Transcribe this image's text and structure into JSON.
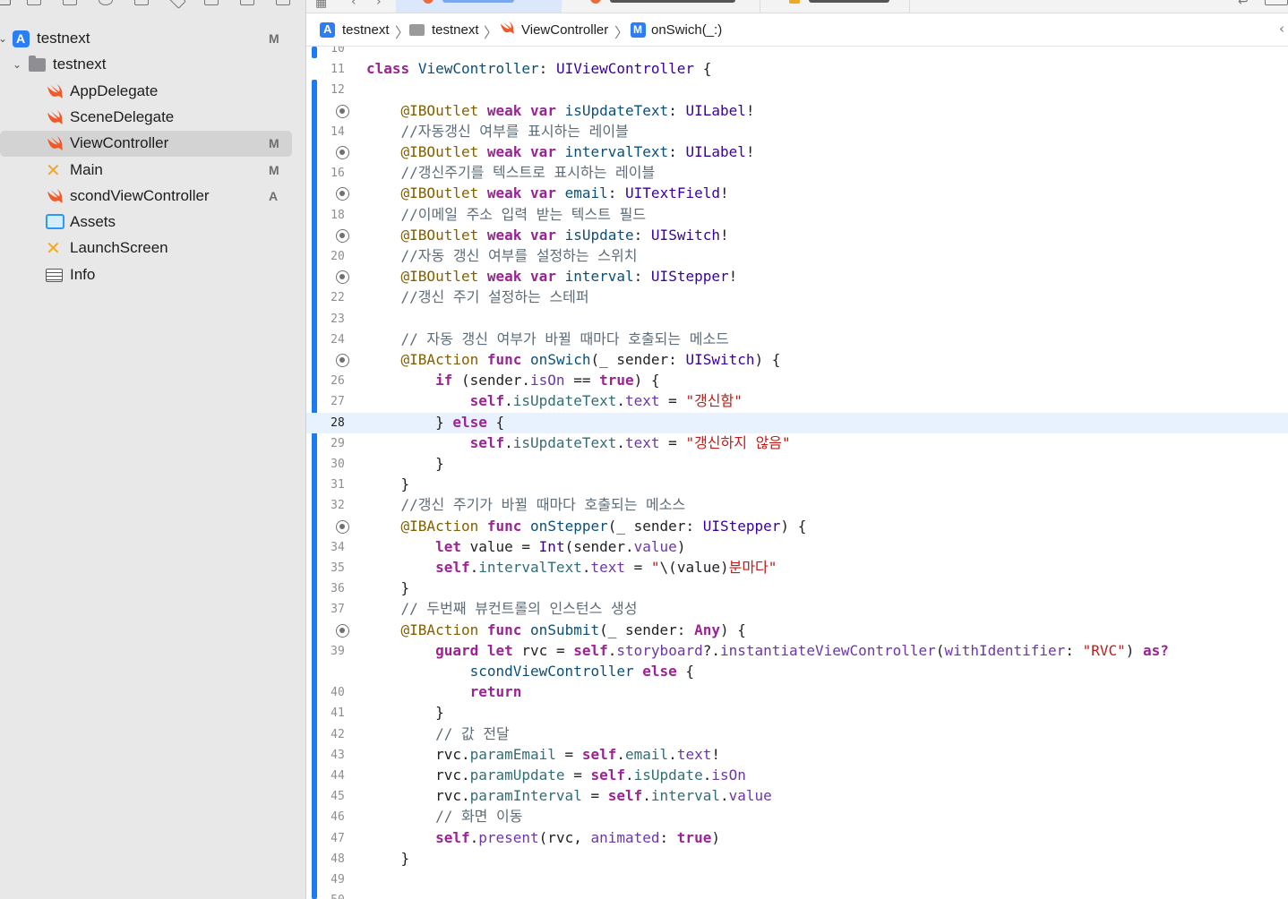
{
  "navigator": {
    "items": [
      {
        "label": "testnext",
        "badge": "M",
        "disclosure": "✓",
        "icon": "app-project-icon",
        "indent": 0
      },
      {
        "label": "testnext",
        "badge": "",
        "disclosure": "⌄",
        "icon": "folder-icon",
        "indent": 1
      },
      {
        "label": "AppDelegate",
        "badge": "",
        "icon": "swift-file-icon",
        "indent": 2
      },
      {
        "label": "SceneDelegate",
        "badge": "",
        "icon": "swift-file-icon",
        "indent": 2
      },
      {
        "label": "ViewController",
        "badge": "M",
        "icon": "swift-file-icon",
        "indent": 2,
        "selected": true
      },
      {
        "label": "Main",
        "badge": "M",
        "icon": "storyboard-icon",
        "indent": 2
      },
      {
        "label": "scondViewController",
        "badge": "A",
        "icon": "swift-file-icon",
        "indent": 2
      },
      {
        "label": "Assets",
        "badge": "",
        "icon": "asset-catalog-icon",
        "indent": 2
      },
      {
        "label": "LaunchScreen",
        "badge": "",
        "icon": "storyboard-icon",
        "indent": 2
      },
      {
        "label": "Info",
        "badge": "",
        "icon": "plist-icon",
        "indent": 2
      }
    ]
  },
  "jumpbar": {
    "crumbs": [
      "testnext",
      "testnext",
      "ViewController",
      "onSwich(_:)"
    ]
  },
  "editor": {
    "current_line": 28,
    "lines": [
      {
        "n": "10",
        "t": []
      },
      {
        "n": "11",
        "t": [
          [
            "kw",
            "class"
          ],
          [
            "plain",
            " "
          ],
          [
            "type",
            "ViewController"
          ],
          [
            "plain",
            ": "
          ],
          [
            "typ2",
            "UIViewController"
          ],
          [
            "plain",
            " {"
          ]
        ]
      },
      {
        "n": "12",
        "t": []
      },
      {
        "n": "",
        "outlet": true,
        "t": [
          [
            "plain",
            "    "
          ],
          [
            "attr",
            "@IBOutlet"
          ],
          [
            "plain",
            " "
          ],
          [
            "kw",
            "weak"
          ],
          [
            "plain",
            " "
          ],
          [
            "kw",
            "var"
          ],
          [
            "plain",
            " "
          ],
          [
            "type",
            "isUpdateText"
          ],
          [
            "plain",
            ": "
          ],
          [
            "typ2",
            "UILabel"
          ],
          [
            "plain",
            "!"
          ]
        ]
      },
      {
        "n": "14",
        "t": [
          [
            "cmt",
            "    //자동갱신 여부를 표시하는 레이블"
          ]
        ]
      },
      {
        "n": "",
        "outlet": true,
        "t": [
          [
            "plain",
            "    "
          ],
          [
            "attr",
            "@IBOutlet"
          ],
          [
            "plain",
            " "
          ],
          [
            "kw",
            "weak"
          ],
          [
            "plain",
            " "
          ],
          [
            "kw",
            "var"
          ],
          [
            "plain",
            " "
          ],
          [
            "type",
            "intervalText"
          ],
          [
            "plain",
            ": "
          ],
          [
            "typ2",
            "UILabel"
          ],
          [
            "plain",
            "!"
          ]
        ]
      },
      {
        "n": "16",
        "t": [
          [
            "cmt",
            "    //갱신주기를 텍스트로 표시하는 레이블"
          ]
        ]
      },
      {
        "n": "",
        "outlet": true,
        "t": [
          [
            "plain",
            "    "
          ],
          [
            "attr",
            "@IBOutlet"
          ],
          [
            "plain",
            " "
          ],
          [
            "kw",
            "weak"
          ],
          [
            "plain",
            " "
          ],
          [
            "kw",
            "var"
          ],
          [
            "plain",
            " "
          ],
          [
            "type",
            "email"
          ],
          [
            "plain",
            ": "
          ],
          [
            "typ2",
            "UITextField"
          ],
          [
            "plain",
            "!"
          ]
        ]
      },
      {
        "n": "18",
        "t": [
          [
            "cmt",
            "    //이메일 주소 입력 받는 텍스트 필드"
          ]
        ]
      },
      {
        "n": "",
        "outlet": true,
        "t": [
          [
            "plain",
            "    "
          ],
          [
            "attr",
            "@IBOutlet"
          ],
          [
            "plain",
            " "
          ],
          [
            "kw",
            "weak"
          ],
          [
            "plain",
            " "
          ],
          [
            "kw",
            "var"
          ],
          [
            "plain",
            " "
          ],
          [
            "type",
            "isUpdate"
          ],
          [
            "plain",
            ": "
          ],
          [
            "typ2",
            "UISwitch"
          ],
          [
            "plain",
            "!"
          ]
        ]
      },
      {
        "n": "20",
        "t": [
          [
            "cmt",
            "    //자동 갱신 여부를 설정하는 스위치"
          ]
        ]
      },
      {
        "n": "",
        "outlet": true,
        "t": [
          [
            "plain",
            "    "
          ],
          [
            "attr",
            "@IBOutlet"
          ],
          [
            "plain",
            " "
          ],
          [
            "kw",
            "weak"
          ],
          [
            "plain",
            " "
          ],
          [
            "kw",
            "var"
          ],
          [
            "plain",
            " "
          ],
          [
            "type",
            "interval"
          ],
          [
            "plain",
            ": "
          ],
          [
            "typ2",
            "UIStepper"
          ],
          [
            "plain",
            "!"
          ]
        ]
      },
      {
        "n": "22",
        "t": [
          [
            "cmt",
            "    //갱신 주기 설정하는 스테퍼"
          ]
        ]
      },
      {
        "n": "23",
        "t": []
      },
      {
        "n": "24",
        "t": [
          [
            "cmt",
            "    // 자동 갱신 여부가 바뀔 때마다 호출되는 메소드"
          ]
        ]
      },
      {
        "n": "",
        "outlet": true,
        "t": [
          [
            "plain",
            "    "
          ],
          [
            "attr",
            "@IBAction"
          ],
          [
            "plain",
            " "
          ],
          [
            "kw",
            "func"
          ],
          [
            "plain",
            " "
          ],
          [
            "type",
            "onSwich"
          ],
          [
            "plain",
            "(_ sender: "
          ],
          [
            "typ2",
            "UISwitch"
          ],
          [
            "plain",
            ") {"
          ]
        ]
      },
      {
        "n": "26",
        "t": [
          [
            "plain",
            "        "
          ],
          [
            "kw",
            "if"
          ],
          [
            "plain",
            " (sender."
          ],
          [
            "prop",
            "isOn"
          ],
          [
            "plain",
            " == "
          ],
          [
            "kw",
            "true"
          ],
          [
            "plain",
            ") {"
          ]
        ]
      },
      {
        "n": "27",
        "t": [
          [
            "plain",
            "            "
          ],
          [
            "kw",
            "self"
          ],
          [
            "plain",
            "."
          ],
          [
            "var",
            "isUpdateText"
          ],
          [
            "plain",
            "."
          ],
          [
            "prop",
            "text"
          ],
          [
            "plain",
            " = "
          ],
          [
            "str",
            "\"갱신함\""
          ]
        ]
      },
      {
        "n": "28",
        "t": [
          [
            "plain",
            "        } "
          ],
          [
            "kw",
            "else"
          ],
          [
            "plain",
            " {"
          ]
        ]
      },
      {
        "n": "29",
        "t": [
          [
            "plain",
            "            "
          ],
          [
            "kw",
            "self"
          ],
          [
            "plain",
            "."
          ],
          [
            "var",
            "isUpdateText"
          ],
          [
            "plain",
            "."
          ],
          [
            "prop",
            "text"
          ],
          [
            "plain",
            " = "
          ],
          [
            "str",
            "\"갱신하지 않음\""
          ]
        ]
      },
      {
        "n": "30",
        "t": [
          [
            "plain",
            "        }"
          ]
        ]
      },
      {
        "n": "31",
        "t": [
          [
            "plain",
            "    }"
          ]
        ]
      },
      {
        "n": "32",
        "t": [
          [
            "cmt",
            "    //갱신 주기가 바뀔 때마다 호출되는 메소스"
          ]
        ]
      },
      {
        "n": "",
        "outlet": true,
        "t": [
          [
            "plain",
            "    "
          ],
          [
            "attr",
            "@IBAction"
          ],
          [
            "plain",
            " "
          ],
          [
            "kw",
            "func"
          ],
          [
            "plain",
            " "
          ],
          [
            "type",
            "onStepper"
          ],
          [
            "plain",
            "(_ sender: "
          ],
          [
            "typ2",
            "UIStepper"
          ],
          [
            "plain",
            ") {"
          ]
        ]
      },
      {
        "n": "34",
        "t": [
          [
            "plain",
            "        "
          ],
          [
            "kw",
            "let"
          ],
          [
            "plain",
            " value = "
          ],
          [
            "typ2",
            "Int"
          ],
          [
            "plain",
            "(sender."
          ],
          [
            "prop",
            "value"
          ],
          [
            "plain",
            ")"
          ]
        ]
      },
      {
        "n": "35",
        "t": [
          [
            "plain",
            "        "
          ],
          [
            "kw",
            "self"
          ],
          [
            "plain",
            "."
          ],
          [
            "var",
            "intervalText"
          ],
          [
            "plain",
            "."
          ],
          [
            "prop",
            "text"
          ],
          [
            "plain",
            " = "
          ],
          [
            "str",
            "\""
          ],
          [
            "plain",
            "\\(value)"
          ],
          [
            "str",
            "분마다\""
          ]
        ]
      },
      {
        "n": "36",
        "t": [
          [
            "plain",
            "    }"
          ]
        ]
      },
      {
        "n": "37",
        "t": [
          [
            "cmt",
            "    // 두번째 뷰컨트롤의 인스턴스 생성"
          ]
        ]
      },
      {
        "n": "",
        "outlet": true,
        "t": [
          [
            "plain",
            "    "
          ],
          [
            "attr",
            "@IBAction"
          ],
          [
            "plain",
            " "
          ],
          [
            "kw",
            "func"
          ],
          [
            "plain",
            " "
          ],
          [
            "type",
            "onSubmit"
          ],
          [
            "plain",
            "(_ sender: "
          ],
          [
            "kw",
            "Any"
          ],
          [
            "plain",
            ") {"
          ]
        ]
      },
      {
        "n": "39",
        "t": [
          [
            "plain",
            "        "
          ],
          [
            "kw",
            "guard"
          ],
          [
            "plain",
            " "
          ],
          [
            "kw",
            "let"
          ],
          [
            "plain",
            " rvc = "
          ],
          [
            "kw",
            "self"
          ],
          [
            "plain",
            "."
          ],
          [
            "prop",
            "storyboard"
          ],
          [
            "plain",
            "?."
          ],
          [
            "prop",
            "instantiateViewController"
          ],
          [
            "plain",
            "("
          ],
          [
            "prop",
            "withIdentifier"
          ],
          [
            "plain",
            ": "
          ],
          [
            "str",
            "\"RVC\""
          ],
          [
            "plain",
            ") "
          ],
          [
            "kw",
            "as?"
          ]
        ]
      },
      {
        "n": "",
        "t": [
          [
            "plain",
            "            "
          ],
          [
            "type",
            "scondViewController"
          ],
          [
            "plain",
            " "
          ],
          [
            "kw",
            "else"
          ],
          [
            "plain",
            " {"
          ]
        ]
      },
      {
        "n": "40",
        "t": [
          [
            "plain",
            "            "
          ],
          [
            "kw",
            "return"
          ]
        ]
      },
      {
        "n": "41",
        "t": [
          [
            "plain",
            "        }"
          ]
        ]
      },
      {
        "n": "42",
        "t": [
          [
            "cmt",
            "        // 값 전달"
          ]
        ]
      },
      {
        "n": "43",
        "t": [
          [
            "plain",
            "        rvc."
          ],
          [
            "var",
            "paramEmail"
          ],
          [
            "plain",
            " = "
          ],
          [
            "kw",
            "self"
          ],
          [
            "plain",
            "."
          ],
          [
            "var",
            "email"
          ],
          [
            "plain",
            "."
          ],
          [
            "prop",
            "text"
          ],
          [
            "plain",
            "!"
          ]
        ]
      },
      {
        "n": "44",
        "t": [
          [
            "plain",
            "        rvc."
          ],
          [
            "var",
            "paramUpdate"
          ],
          [
            "plain",
            " = "
          ],
          [
            "kw",
            "self"
          ],
          [
            "plain",
            "."
          ],
          [
            "var",
            "isUpdate"
          ],
          [
            "plain",
            "."
          ],
          [
            "prop",
            "isOn"
          ]
        ]
      },
      {
        "n": "45",
        "t": [
          [
            "plain",
            "        rvc."
          ],
          [
            "var",
            "paramInterval"
          ],
          [
            "plain",
            " = "
          ],
          [
            "kw",
            "self"
          ],
          [
            "plain",
            "."
          ],
          [
            "var",
            "interval"
          ],
          [
            "plain",
            "."
          ],
          [
            "prop",
            "value"
          ]
        ]
      },
      {
        "n": "46",
        "t": [
          [
            "cmt",
            "        // 화면 이동"
          ]
        ]
      },
      {
        "n": "47",
        "t": [
          [
            "plain",
            "        "
          ],
          [
            "kw",
            "self"
          ],
          [
            "plain",
            "."
          ],
          [
            "prop",
            "present"
          ],
          [
            "plain",
            "(rvc, "
          ],
          [
            "prop",
            "animated"
          ],
          [
            "plain",
            ": "
          ],
          [
            "kw",
            "true"
          ],
          [
            "plain",
            ")"
          ]
        ]
      },
      {
        "n": "48",
        "t": [
          [
            "plain",
            "    }"
          ]
        ]
      },
      {
        "n": "49",
        "t": []
      },
      {
        "n": "50",
        "t": []
      }
    ]
  }
}
